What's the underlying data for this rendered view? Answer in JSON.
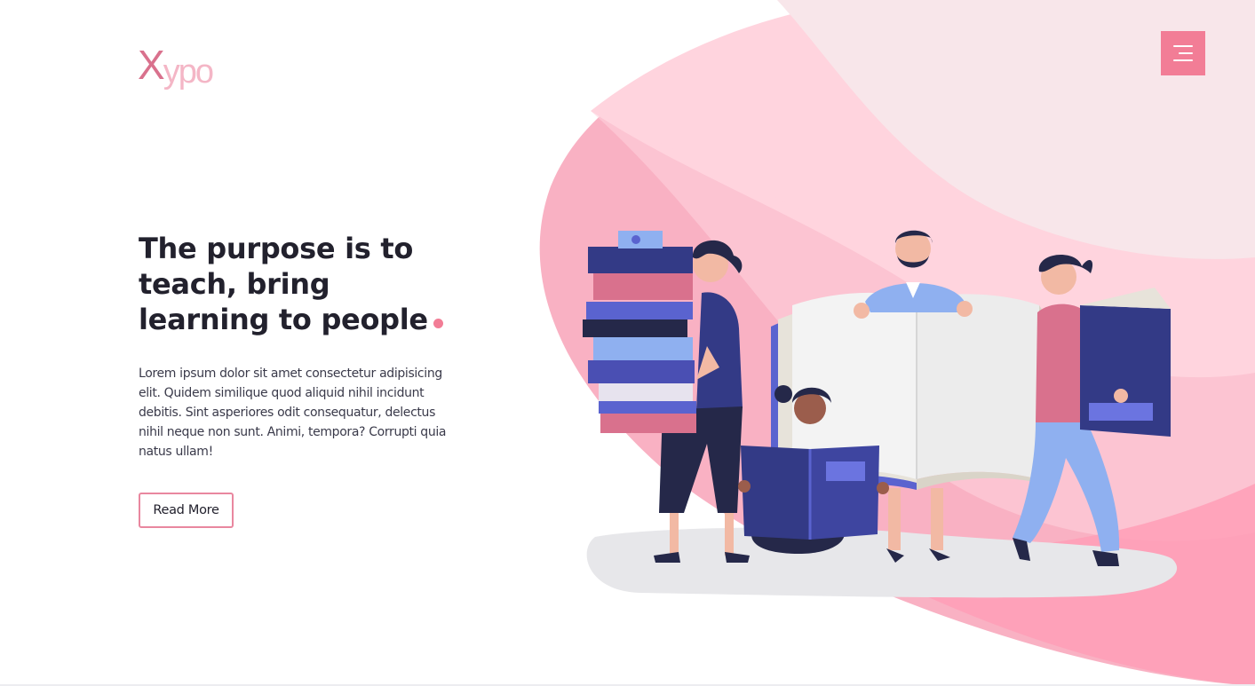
{
  "logo": {
    "letter": "X",
    "rest": "ypo"
  },
  "nav": {
    "menu_icon": "hamburger-menu-icon"
  },
  "hero": {
    "title": "The purpose is to teach, bring learning to people",
    "body": "Lorem ipsum dolor sit amet consectetur adipisicing elit. Quidem similique quod aliquid nihil incidunt debitis. Sint asperiores odit consequatur, delectus nihil neque non sunt. Animi, tempora? Corrupti quia natus ullam!",
    "cta_label": "Read More"
  },
  "colors": {
    "accent": "#f27d96",
    "title": "#22212d",
    "blob_light": "#f8e6ea",
    "blob_mid": "#ffd4de",
    "blob_deep": "#f9b1c3",
    "navy": "#333a86",
    "blue": "#5a63cf"
  }
}
